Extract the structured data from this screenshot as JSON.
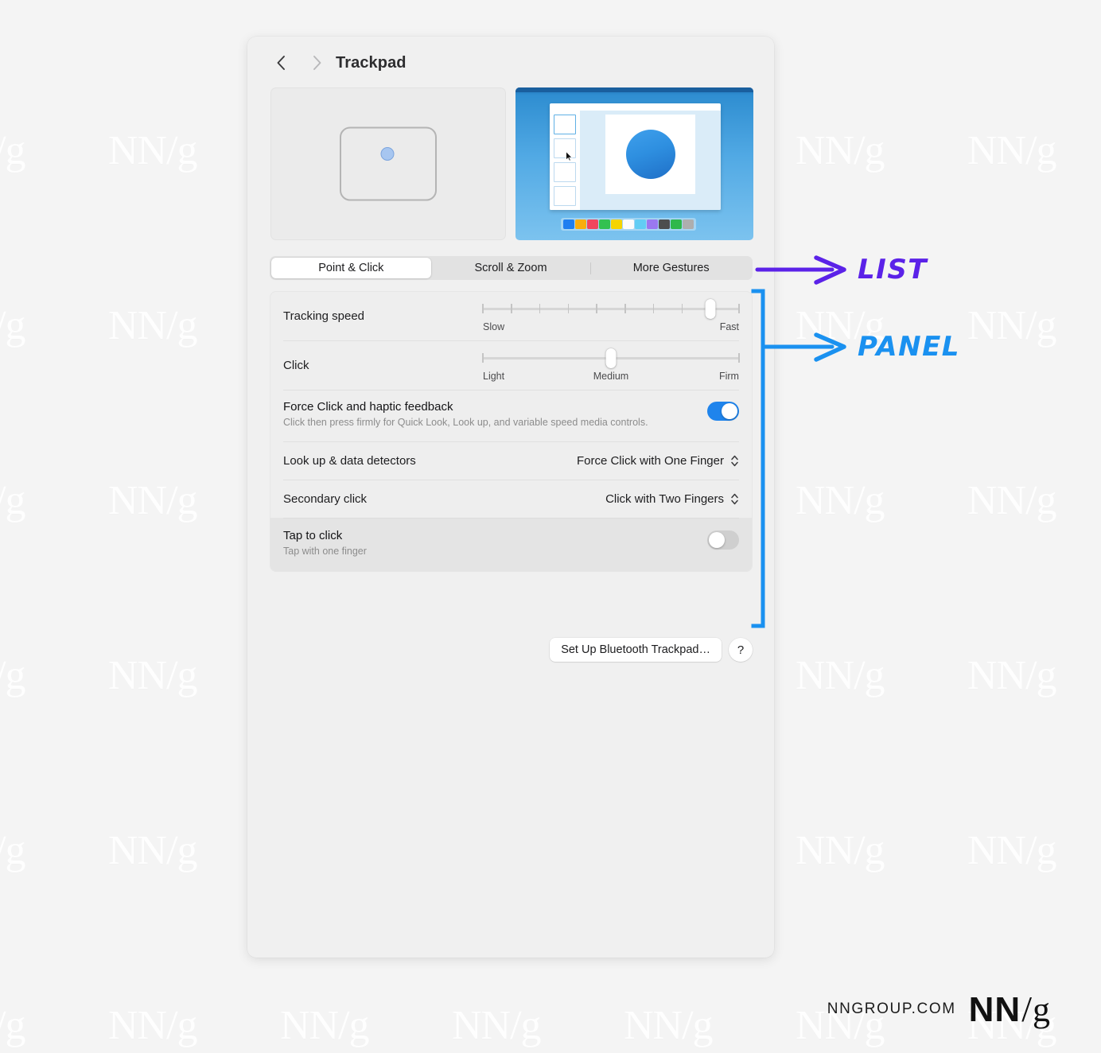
{
  "window": {
    "title": "Trackpad",
    "nav": {
      "back_icon": "chevron-left-icon",
      "forward_icon": "chevron-right-icon"
    }
  },
  "preview": {
    "trackpad_illustration": "trackpad-outline-with-pointer-dot",
    "video_illustration": "keynote-demo-video-thumbnail",
    "palette_colors": [
      "#1f7ef0",
      "#f9ad0e",
      "#f2465e",
      "#33c151",
      "#f5d400",
      "#fbfbfb",
      "#62cdf4",
      "#9a78f0",
      "#4d4d4d",
      "#2fb84b",
      "#aeaeae"
    ]
  },
  "tabs": [
    {
      "label": "Point & Click",
      "active": true
    },
    {
      "label": "Scroll & Zoom",
      "active": false
    },
    {
      "label": "More Gestures",
      "active": false
    }
  ],
  "settings": {
    "tracking_speed": {
      "label": "Tracking speed",
      "min_label": "Slow",
      "max_label": "Fast",
      "ticks": 10,
      "value_index": 8
    },
    "click": {
      "label": "Click",
      "min_label": "Light",
      "mid_label": "Medium",
      "max_label": "Firm",
      "ticks": 3,
      "value_index": 1
    },
    "force_click": {
      "label": "Force Click and haptic feedback",
      "description": "Click then press firmly for Quick Look, Look up, and variable speed media controls.",
      "toggle_state": "on"
    },
    "look_up": {
      "label": "Look up & data detectors",
      "value": "Force Click with One Finger"
    },
    "secondary_click": {
      "label": "Secondary click",
      "value": "Click with Two Fingers"
    },
    "tap_to_click": {
      "label": "Tap to click",
      "description": "Tap with one finger",
      "toggle_state": "off"
    }
  },
  "buttons": {
    "setup_bluetooth": "Set Up Bluetooth Trackpad…",
    "help": "?"
  },
  "annotations": [
    {
      "label": "LIST",
      "color": "#5b22e8",
      "target": "segmented-tab-bar"
    },
    {
      "label": "PANEL",
      "color": "#1a91f0",
      "target": "settings-card"
    }
  ],
  "footer": {
    "url": "NNGROUP.COM",
    "logo_nn": "NN",
    "logo_slash": "/",
    "logo_g": "g"
  },
  "watermark": {
    "text": "NN/g"
  }
}
